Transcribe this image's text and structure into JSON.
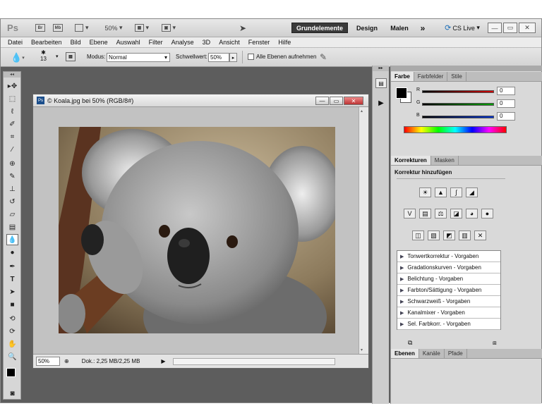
{
  "app": {
    "logo": "Ps",
    "zoom": "50%",
    "workspaces": [
      "Grundelemente",
      "Design",
      "Malen"
    ],
    "more": "»",
    "cs_live": "CS Live"
  },
  "menu": [
    "Datei",
    "Bearbeiten",
    "Bild",
    "Ebene",
    "Auswahl",
    "Filter",
    "Analyse",
    "3D",
    "Ansicht",
    "Fenster",
    "Hilfe"
  ],
  "options": {
    "brush_size": "13",
    "mode_label": "Modus:",
    "mode_value": "Normal",
    "threshold_label": "Schwellwert:",
    "threshold_value": "50%",
    "all_layers_label": "Alle Ebenen aufnehmen"
  },
  "document": {
    "title": "© Koala.jpg bei 50% (RGB/8#)",
    "zoom": "50%",
    "doc_info": "Dok.: 2,25 MB/2,25 MB"
  },
  "color_panel": {
    "tabs": [
      "Farbe",
      "Farbfelder",
      "Stile"
    ],
    "r": "0",
    "g": "0",
    "b": "0",
    "r_label": "R",
    "g_label": "G",
    "b_label": "B"
  },
  "adjust_panel": {
    "tabs": [
      "Korrekturen",
      "Masken"
    ],
    "heading": "Korrektur hinzufügen",
    "presets": [
      "Tonwertkorrektur - Vorgaben",
      "Gradationskurven - Vorgaben",
      "Belichtung - Vorgaben",
      "Farbton/Sättigung - Vorgaben",
      "Schwarzweiß - Vorgaben",
      "Kanalmixer - Vorgaben",
      "Sel. Farbkorr. - Vorgaben"
    ]
  },
  "layers_panel": {
    "tabs": [
      "Ebenen",
      "Kanäle",
      "Pfade"
    ]
  },
  "colors": {
    "workspace_active": "#3a3a3a",
    "red": "#d00000",
    "green": "#00a000",
    "blue": "#0030d0"
  }
}
